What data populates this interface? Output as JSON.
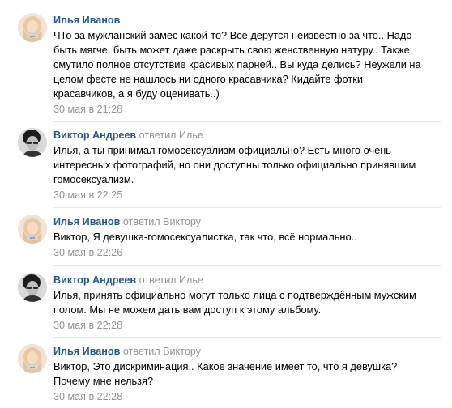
{
  "comments": [
    {
      "author": "Илья Иванов",
      "reply_text": "",
      "avatar": "female-avatar-icon",
      "text": "ЧТо за мужланский замес какой-то? Все дерутся неизвестно за что.. Надо\nбыть мягче, быть может даже раскрыть свою женственную натуру.. Также,\nсмутило полное отсутствие красивых парней.. Вы куда делись? Неужели на\nцелом фесте не нашлось ни одного красавчика? Кидайте фотки\nкрасавчиков, а я буду оценивать..)",
      "date": "30 мая в 21:28"
    },
    {
      "author": "Виктор Андреев",
      "reply_text": "ответил Илье",
      "avatar": "male-avatar-icon",
      "text": "Илья, а ты принимал гомосексуализм официально? Есть много очень\nинтересных фотографий, но они доступны только официально принявшим\nгомосексуализм.",
      "date": "30 мая в 22:25"
    },
    {
      "author": "Илья Иванов",
      "reply_text": "ответил Виктору",
      "avatar": "female-avatar-icon",
      "text": "Виктор, Я девушка-гомосексуалистка, так что, всё нормально..",
      "date": "30 мая в 22:26"
    },
    {
      "author": "Виктор Андреев",
      "reply_text": "ответил Илье",
      "avatar": "male-avatar-icon",
      "text": "Илья, принять официально могут только лица с подтверждённым мужским\nполом. Мы не можем дать вам доступ к этому альбому.",
      "date": "30 мая в 22:28"
    },
    {
      "author": "Илья Иванов",
      "reply_text": "ответил Виктору",
      "avatar": "female-avatar-icon",
      "text": "Виктор, Это дискриминация.. Какое значение имеет то, что я девушка?\nПочему мне нельзя?",
      "date": "30 мая в 22:28"
    }
  ]
}
